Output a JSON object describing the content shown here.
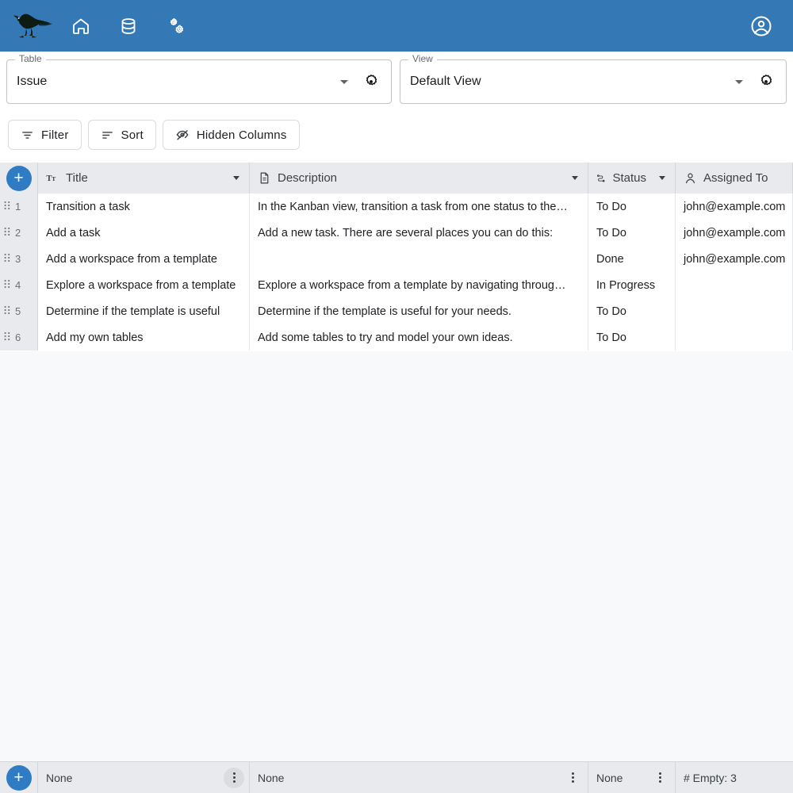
{
  "theme": {
    "appbar_bg": "#3478b5",
    "accent": "#2f7cc4",
    "header_bg": "#e8eaed",
    "grid_fill": "#f8f9fb",
    "border": "#d4d6d9"
  },
  "appbar": {
    "logo_name": "bird-logo",
    "nav": [
      {
        "name": "home-icon",
        "label": "Home"
      },
      {
        "name": "database-icon",
        "label": "Database"
      },
      {
        "name": "settings-gears-icon",
        "label": "Settings"
      }
    ],
    "account": {
      "name": "account-circle-icon",
      "label": "Account"
    }
  },
  "selectors": {
    "table": {
      "legend": "Table",
      "value": "Issue",
      "gear_label": "Table settings"
    },
    "view": {
      "legend": "View",
      "value": "Default View",
      "gear_label": "View settings"
    }
  },
  "toolbar": {
    "filter_label": "Filter",
    "sort_label": "Sort",
    "hidden_columns_label": "Hidden Columns"
  },
  "grid": {
    "add_row_label": "+",
    "columns": [
      {
        "key": "title",
        "label": "Title",
        "icon": "text-format-icon",
        "has_menu": true
      },
      {
        "key": "description",
        "label": "Description",
        "icon": "document-icon",
        "has_menu": true
      },
      {
        "key": "status",
        "label": "Status",
        "icon": "single-select-icon",
        "has_menu": true
      },
      {
        "key": "assigned_to",
        "label": "Assigned To",
        "icon": "person-icon",
        "has_menu": false
      }
    ],
    "rows": [
      {
        "num": "1",
        "title": "Transition a task",
        "description": "In the Kanban view, transition a task from one status to the…",
        "status": "To Do",
        "assigned_to": "john@example.com"
      },
      {
        "num": "2",
        "title": "Add a task",
        "description": "Add a new task. There are several places you can do this:",
        "status": "To Do",
        "assigned_to": "john@example.com"
      },
      {
        "num": "3",
        "title": "Add a workspace from a template",
        "description": "",
        "status": "Done",
        "assigned_to": "john@example.com"
      },
      {
        "num": "4",
        "title": "Explore a workspace from a template",
        "description": "Explore a workspace from a template by navigating throug…",
        "status": "In Progress",
        "assigned_to": ""
      },
      {
        "num": "5",
        "title": "Determine if the template is useful",
        "description": "Determine if the template is useful for your needs.",
        "status": "To Do",
        "assigned_to": ""
      },
      {
        "num": "6",
        "title": "Add my own tables",
        "description": "Add some tables to try and model your own ideas.",
        "status": "To Do",
        "assigned_to": ""
      }
    ]
  },
  "footer": {
    "add_row_label": "+",
    "summaries": [
      {
        "column": "title",
        "value": "None",
        "has_more": true
      },
      {
        "column": "description",
        "value": "None",
        "has_more": true
      },
      {
        "column": "status",
        "value": "None",
        "has_more": true
      },
      {
        "column": "assigned_to",
        "value": "# Empty: 3",
        "has_more": false
      }
    ]
  }
}
